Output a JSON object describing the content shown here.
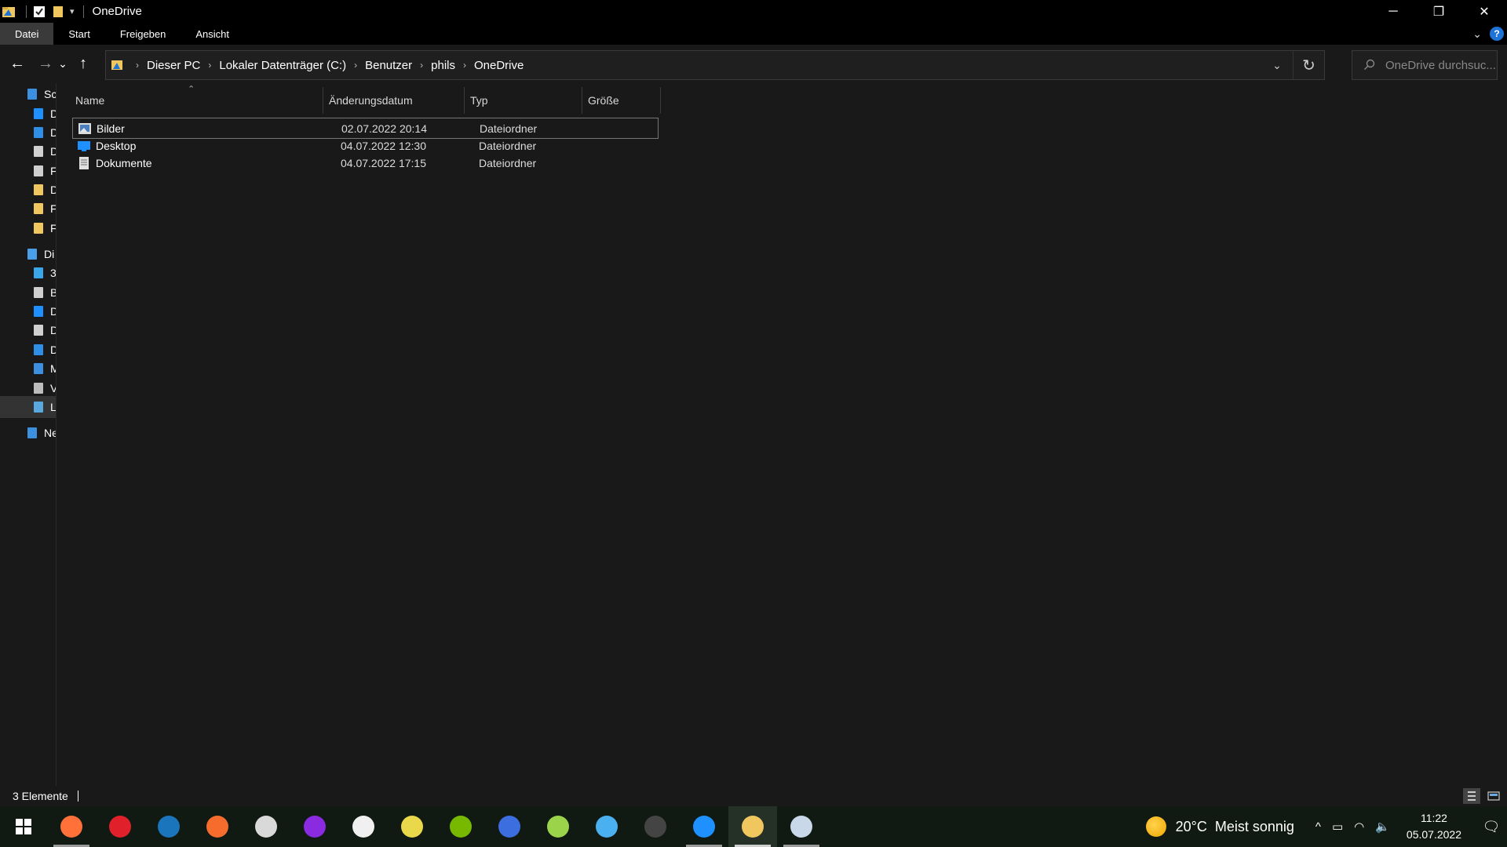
{
  "window": {
    "title": "OneDrive",
    "controls": {
      "minimize": "─",
      "restore": "❐",
      "close": "✕"
    }
  },
  "ribbon": {
    "tabs": [
      {
        "label": "Datei",
        "active": true
      },
      {
        "label": "Start"
      },
      {
        "label": "Freigeben"
      },
      {
        "label": "Ansicht"
      }
    ],
    "help": "?"
  },
  "nav": {
    "back": "←",
    "forward": "→",
    "recent": "⌄",
    "up": "↑",
    "breadcrumb": [
      "Dieser PC",
      "Lokaler Datenträger (C:)",
      "Benutzer",
      "phils",
      "OneDrive"
    ],
    "refresh": "↻",
    "dropdown": "⌄"
  },
  "search": {
    "placeholder": "OneDrive durchsuc..."
  },
  "sidebar": {
    "items": [
      {
        "label": "Sc",
        "icon": "star-icon",
        "color": "#3d8fe0"
      },
      {
        "label": "D",
        "icon": "desktop-folder-icon",
        "color": "#1e90ff"
      },
      {
        "label": "D",
        "icon": "download-icon",
        "color": "#2f8ee5"
      },
      {
        "label": "D",
        "icon": "document-icon",
        "color": "#d0d0d0"
      },
      {
        "label": "F",
        "icon": "pictures-icon",
        "color": "#cfcfcf"
      },
      {
        "label": "D",
        "icon": "folder-icon",
        "color": "#f0c75e"
      },
      {
        "label": "F",
        "icon": "folder-icon",
        "color": "#f0c75e"
      },
      {
        "label": "F",
        "icon": "folder-icon",
        "color": "#f0c75e"
      },
      {
        "label": "Di",
        "icon": "pc-icon",
        "color": "#4aa0e8"
      },
      {
        "label": "3",
        "icon": "objects-3d-icon",
        "color": "#3aa8e8"
      },
      {
        "label": "B",
        "icon": "pictures-icon",
        "color": "#cfcfcf"
      },
      {
        "label": "D",
        "icon": "desktop-folder-icon",
        "color": "#1e90ff"
      },
      {
        "label": "D",
        "icon": "document-icon",
        "color": "#d0d0d0"
      },
      {
        "label": "D",
        "icon": "download-icon",
        "color": "#2f8ee5"
      },
      {
        "label": "M",
        "icon": "music-icon",
        "color": "#3d8fe0"
      },
      {
        "label": "V",
        "icon": "video-icon",
        "color": "#bdbdbd"
      },
      {
        "label": "L",
        "icon": "drive-icon",
        "color": "#5aa8e0",
        "selected": true
      },
      {
        "label": "Ne",
        "icon": "network-icon",
        "color": "#3d8fe0"
      }
    ]
  },
  "columns": [
    "Name",
    "Änderungsdatum",
    "Typ",
    "Größe"
  ],
  "sort_indicator": "⌃",
  "files": [
    {
      "name": "Bilder",
      "date": "02.07.2022 20:14",
      "type": "Dateiordner",
      "icon": "pictures-folder-icon"
    },
    {
      "name": "Desktop",
      "date": "04.07.2022 12:30",
      "type": "Dateiordner",
      "icon": "desktop-folder-icon"
    },
    {
      "name": "Dokumente",
      "date": "04.07.2022 17:15",
      "type": "Dateiordner",
      "icon": "documents-folder-icon"
    }
  ],
  "status": {
    "count": "3 Elemente"
  },
  "taskbar": {
    "apps": [
      {
        "name": "firefox-icon",
        "color": "#ff7139",
        "running": true
      },
      {
        "name": "opera-icon",
        "color": "#e0202a"
      },
      {
        "name": "steam-icon",
        "color": "#1b75bc"
      },
      {
        "name": "origin-icon",
        "color": "#f56c2d"
      },
      {
        "name": "ubisoft-icon",
        "color": "#d9d9d9"
      },
      {
        "name": "circle-app-icon",
        "color": "#8a2be2"
      },
      {
        "name": "store-icon",
        "color": "#f0f0f0"
      },
      {
        "name": "calculator-icon",
        "color": "#e8d84a"
      },
      {
        "name": "nvidia-icon",
        "color": "#76b900"
      },
      {
        "name": "monitor-icon",
        "color": "#3c6ee0"
      },
      {
        "name": "xbox-icon",
        "color": "#9bd34a"
      },
      {
        "name": "equalizer-icon",
        "color": "#4ab0f0"
      },
      {
        "name": "dark-orb-icon",
        "color": "#444444"
      },
      {
        "name": "onedrive-icon",
        "color": "#1e90ff",
        "running": true
      },
      {
        "name": "file-explorer-icon",
        "color": "#f0c75e",
        "running": true,
        "active": true
      },
      {
        "name": "paint-icon",
        "color": "#c8d8e8",
        "running": true
      }
    ],
    "weather": {
      "temp": "20°C",
      "text": "Meist sonnig"
    },
    "clock": {
      "time": "11:22",
      "date": "05.07.2022"
    },
    "tray_icons": {
      "chevron": "^",
      "battery": "▭",
      "wifi": "◠",
      "volume": "🔈"
    },
    "notification": "🗨"
  }
}
